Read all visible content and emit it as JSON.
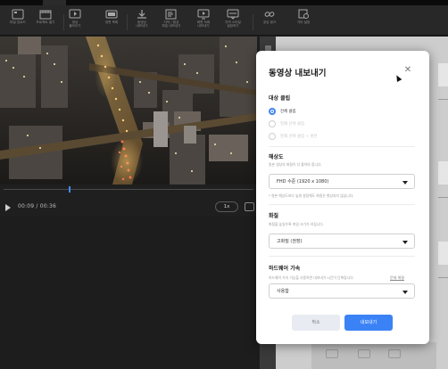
{
  "toolbar": {
    "items": [
      {
        "label": "파일 업로드",
        "icon": "upload-film-icon"
      },
      {
        "label": "프로젝트 열기",
        "icon": "film-open-icon"
      },
      {
        "label": "영상\n불러오기",
        "icon": "video-import-icon"
      },
      {
        "label": "장면 목록",
        "icon": "scene-list-icon"
      },
      {
        "label": "동영상\n내보내기",
        "icon": "download-icon"
      },
      {
        "label": "자막 / 음성\n파일 내보내기",
        "icon": "subtitle-export-icon"
      },
      {
        "label": "화면 녹화\n내보내기",
        "icon": "screen-export-icon"
      },
      {
        "label": "자막 스타일\n설정하기",
        "icon": "caption-style-icon"
      },
      {
        "label": "공유 링크",
        "icon": "link-icon"
      },
      {
        "label": "기타 설정",
        "icon": "settings-icon"
      }
    ]
  },
  "player": {
    "timecode": "00:09 / 00:36",
    "speed": "1x",
    "progress": 0.26
  },
  "modal": {
    "title": "동영상 내보내기",
    "close_icon": "close-icon",
    "target": {
      "heading": "대상 클립",
      "options": [
        {
          "label": "전체 클립",
          "selected": true
        },
        {
          "label": "현재 선택 클립",
          "selected": false
        },
        {
          "label": "현재 선택 클립 + 원본",
          "selected": false
        }
      ]
    },
    "resolution": {
      "heading": "해상도",
      "description": "원본 영상의 화질이 더 좋아야 합니다.",
      "value": "FHD 수준 (1920 x 1080)",
      "note": "* 원본 해상도보다 높게 설정해도 화질은 향상되지 않습니다."
    },
    "quality": {
      "heading": "화질",
      "description": "화질을 높일수록 파일 크기가 커집니다.",
      "value": "고화질 (권장)"
    },
    "hardware": {
      "heading": "하드웨어 가속",
      "description": "하드웨어 가속 기능을 사용하면 내보내기 시간이 단축됩니다.",
      "link": "문제 해결",
      "value": "사용함"
    },
    "buttons": {
      "cancel": "취소",
      "export": "내보내기"
    }
  },
  "colors": {
    "accent": "#3b82f6",
    "toolbar_bg": "#282828",
    "modal_bg": "#ffffff"
  }
}
